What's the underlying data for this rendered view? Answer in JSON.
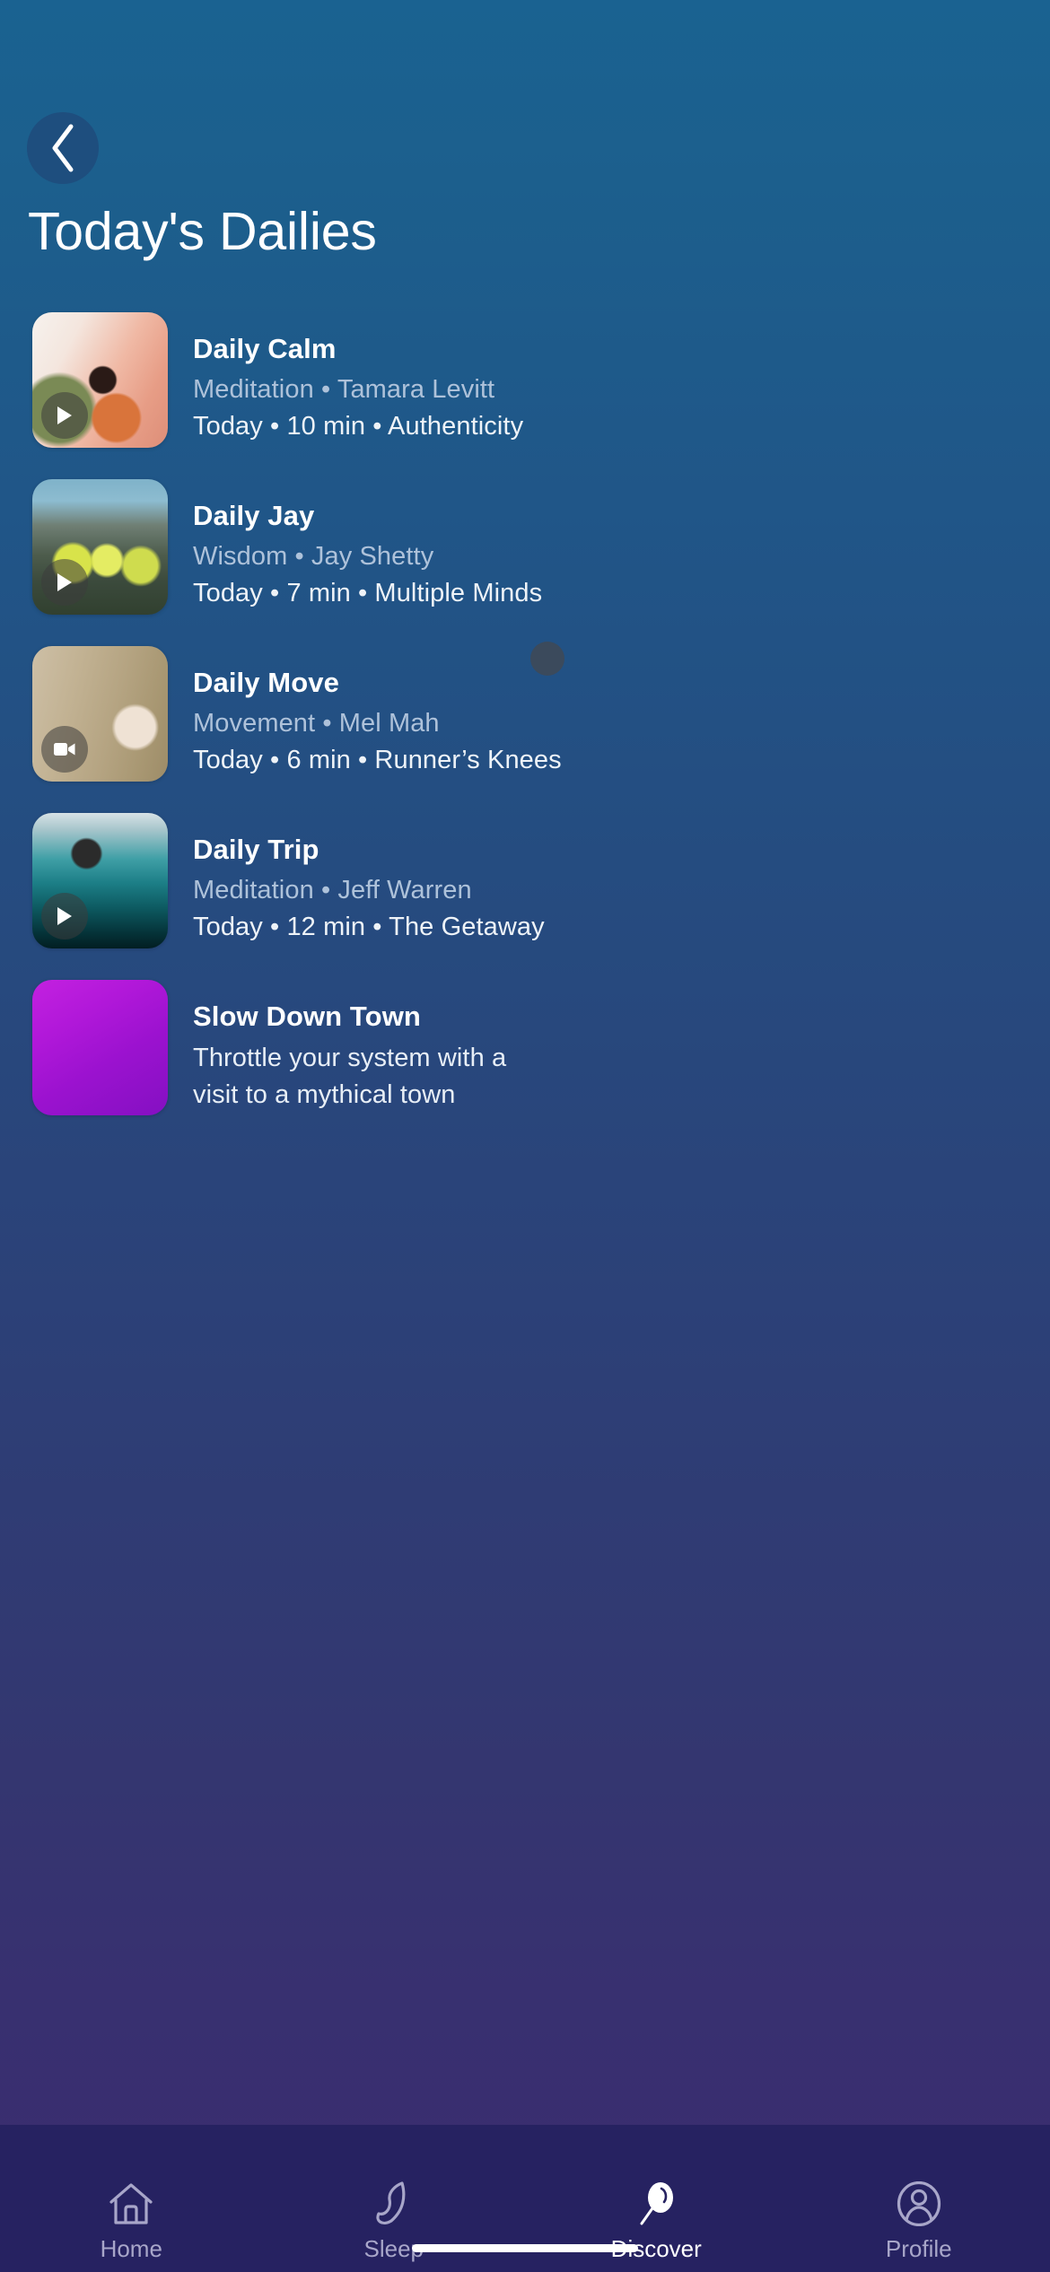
{
  "colors": {
    "bg_top": "#1a6291",
    "bg_bottom": "#3b2c6f",
    "tabbar_bg": "#262261",
    "back_btn_bg": "#1e4e7e",
    "accent_active": "#ffffff",
    "subtitle_muted": "#aec2da",
    "tab_inactive": "#a8a6c9",
    "town_tile_from": "#c321e0",
    "town_tile_to": "#8410c2",
    "dot_badge": "#3b4a5c"
  },
  "header": {
    "back_icon": "chevron-left-icon",
    "title": "Today's Dailies"
  },
  "list": {
    "items": [
      {
        "title": "Daily Calm",
        "subtitle": "Meditation • Tamara Levitt",
        "meta": "Today • 10 min • Authenticity",
        "badge_icon": "play-icon",
        "art": "art-calm",
        "has_dot": true
      },
      {
        "title": "Daily Jay",
        "subtitle": "Wisdom • Jay Shetty",
        "meta": "Today • 7 min • Multiple Minds",
        "badge_icon": "play-icon",
        "art": "art-jay",
        "has_dot": false
      },
      {
        "title": "Daily Move",
        "subtitle": "Movement • Mel Mah",
        "meta": "Today • 6 min • Runner’s Knees",
        "badge_icon": "video-camera-icon",
        "art": "art-move",
        "has_dot": false
      },
      {
        "title": "Daily Trip",
        "subtitle": "Meditation • Jeff Warren",
        "meta": "Today • 12 min • The Getaway",
        "badge_icon": "play-icon",
        "art": "art-trip",
        "has_dot": false
      },
      {
        "title": "Slow Down Town",
        "subtitle": "",
        "meta": "",
        "description": "Throttle your system with a visit to a mythical town",
        "badge_icon": "",
        "art": "art-town",
        "has_dot": false
      }
    ]
  },
  "tabbar": {
    "items": [
      {
        "label": "Home",
        "icon": "home-icon",
        "active": false
      },
      {
        "label": "Sleep",
        "icon": "moon-icon",
        "active": false
      },
      {
        "label": "Discover",
        "icon": "search-icon",
        "active": true
      },
      {
        "label": "Profile",
        "icon": "user-circle-icon",
        "active": false
      }
    ]
  }
}
